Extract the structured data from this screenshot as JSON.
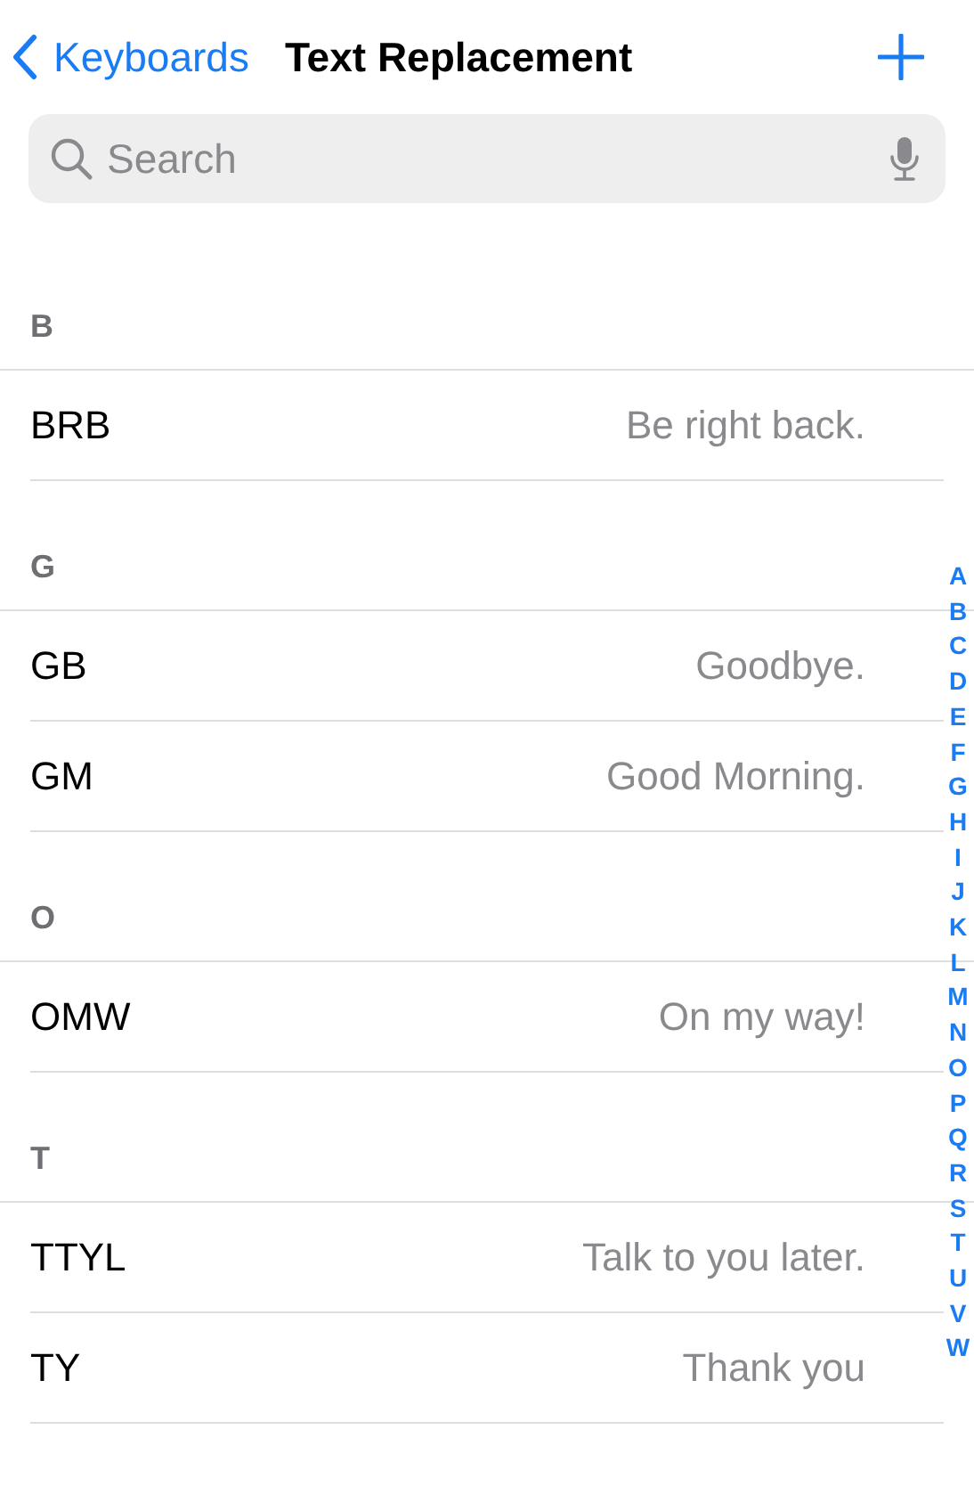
{
  "nav": {
    "back_label": "Keyboards",
    "title": "Text Replacement"
  },
  "search": {
    "placeholder": "Search"
  },
  "sections": [
    {
      "letter": "B",
      "rows": [
        {
          "shortcut": "BRB",
          "phrase": "Be right back."
        }
      ]
    },
    {
      "letter": "G",
      "rows": [
        {
          "shortcut": "GB",
          "phrase": "Goodbye."
        },
        {
          "shortcut": "GM",
          "phrase": "Good Morning."
        }
      ]
    },
    {
      "letter": "O",
      "rows": [
        {
          "shortcut": "OMW",
          "phrase": "On my way!"
        }
      ]
    },
    {
      "letter": "T",
      "rows": [
        {
          "shortcut": "TTYL",
          "phrase": "Talk to you later."
        },
        {
          "shortcut": "TY",
          "phrase": "Thank you"
        }
      ]
    }
  ],
  "index_letters": [
    "A",
    "B",
    "C",
    "D",
    "E",
    "F",
    "G",
    "H",
    "I",
    "J",
    "K",
    "L",
    "M",
    "N",
    "O",
    "P",
    "Q",
    "R",
    "S",
    "T",
    "U",
    "V",
    "W"
  ]
}
